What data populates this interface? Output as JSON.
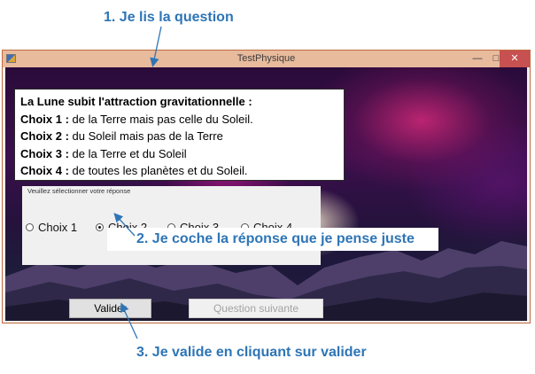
{
  "annotations": {
    "step1": "1.  Je lis la question",
    "step2": "2.  Je coche la réponse que je pense juste",
    "step3": "3.  Je valide en cliquant sur valider"
  },
  "window": {
    "title": "TestPhysique",
    "controls": {
      "minimize": "—",
      "maximize": "□",
      "close": "✕"
    }
  },
  "question": {
    "title": "La Lune subit l'attraction gravitationnelle :",
    "choices": [
      {
        "label": "Choix 1 :",
        "text": " de la Terre mais pas celle du Soleil."
      },
      {
        "label": "Choix 2 :",
        "text": " du Soleil mais pas de la Terre"
      },
      {
        "label": "Choix 3 :",
        "text": " de la Terre et du Soleil"
      },
      {
        "label": "Choix 4 :",
        "text": " de toutes les planètes et du Soleil."
      }
    ]
  },
  "answer_panel": {
    "legend": "Veuillez sélectionner votre réponse",
    "options": [
      "Choix 1",
      "Choix 2",
      "Choix 3",
      "Choix 4"
    ],
    "selected": "Choix 2"
  },
  "buttons": {
    "validate": "Valider",
    "next": "Question suivante"
  },
  "colors": {
    "annotation": "#2e75b6",
    "titlebar": "#e8bb9d",
    "close_button": "#c75050"
  }
}
